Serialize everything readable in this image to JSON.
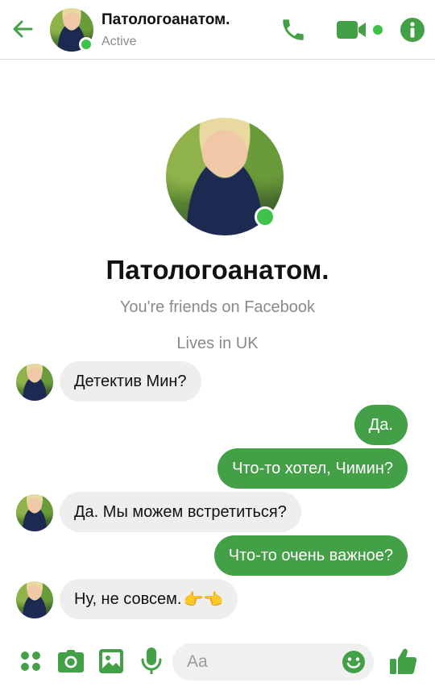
{
  "header": {
    "contact_name": "Патологоанатом.",
    "status": "Active"
  },
  "profile": {
    "name": "Патологоанатом.",
    "friends_text": "You're friends on Facebook",
    "location_text": "Lives in UK"
  },
  "messages": [
    {
      "direction": "in",
      "text": "Детектив Мин?"
    },
    {
      "direction": "out",
      "text": "Да."
    },
    {
      "direction": "out",
      "text": "Что-то хотел, Чимин?"
    },
    {
      "direction": "in",
      "text": "Да. Мы можем встретиться?"
    },
    {
      "direction": "out",
      "text": "Что-то очень важное?"
    },
    {
      "direction": "in",
      "text": "Ну, не совсем.",
      "emoji": "👉👈"
    }
  ],
  "composer": {
    "placeholder": "Aa"
  },
  "colors": {
    "accent": "#43a047",
    "online": "#3ec24a",
    "incoming_bubble": "#eeeeee"
  },
  "icons": {
    "back": "back-arrow-icon",
    "call": "phone-icon",
    "video": "video-camera-icon",
    "info": "info-icon",
    "apps": "grid-dots-icon",
    "camera": "camera-icon",
    "gallery": "image-icon",
    "mic": "microphone-icon",
    "emoji": "smiley-icon",
    "like": "thumbs-up-icon"
  }
}
